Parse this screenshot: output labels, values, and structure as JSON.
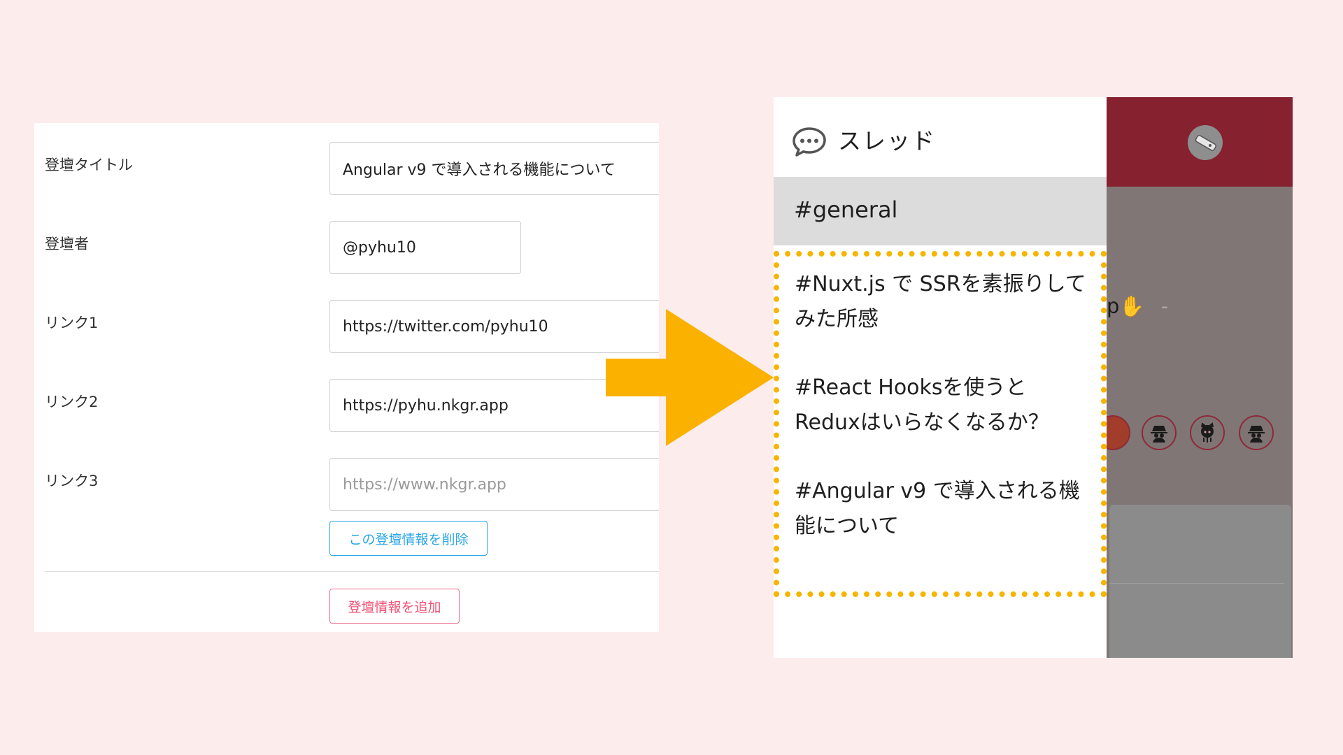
{
  "form": {
    "title_label": "登壇タイトル",
    "title_value": "Angular v9 で導入される機能について",
    "speaker_label": "登壇者",
    "speaker_value": "@pyhu10",
    "link1_label": "リンク1",
    "link1_value": "https://twitter.com/pyhu10",
    "link2_label": "リンク2",
    "link2_value": "https://pyhu.nkgr.app",
    "link3_label": "リンク3",
    "link3_placeholder": "https://www.nkgr.app",
    "delete_button": "この登壇情報を削除",
    "add_button": "登壇情報を追加"
  },
  "app": {
    "drawer_title": "スレッド",
    "channel": "#general",
    "threads": [
      "#Nuxt.js で SSRを素振りしてみた所感",
      "#React Hooksを使うとReduxはいらなくなるか？",
      "#Angular v9 で導入される機能について"
    ],
    "peek_text": "p✋",
    "peek_dash": "-"
  },
  "colors": {
    "background": "#fdecec",
    "arrow": "#fbb100",
    "highlight_border": "#f7b500",
    "header_red": "#86212f",
    "delete_blue": "#2aa6e6",
    "add_red": "#f04e73"
  },
  "icons": [
    "speech-bubble-icon",
    "app-logo-icon",
    "spy-avatar-icon",
    "octocat-avatar-icon",
    "arrow-right-icon"
  ]
}
